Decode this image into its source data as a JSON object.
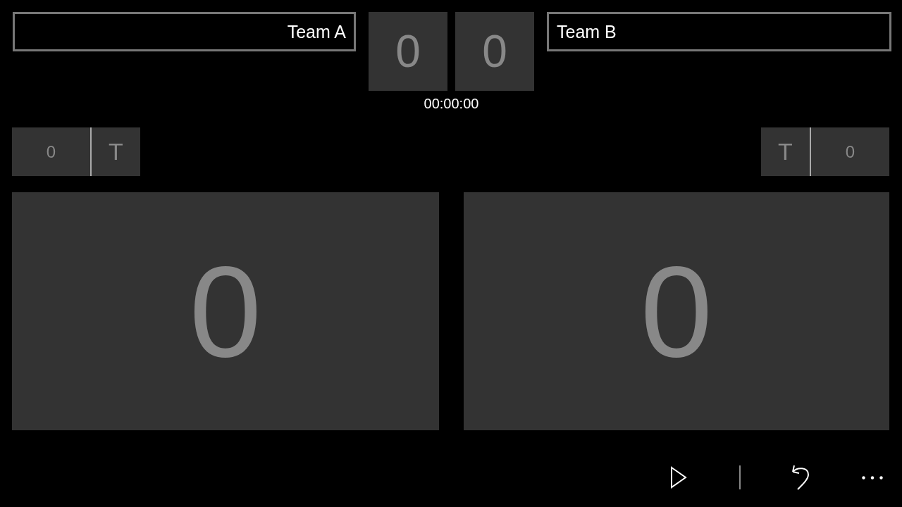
{
  "teams": [
    {
      "kind": "home",
      "name": "Team A",
      "set_score": "0",
      "timeouts": "0",
      "timeout_label": "T",
      "score": "0"
    },
    {
      "kind": "away",
      "name": "Team B",
      "set_score": "0",
      "timeouts": "0",
      "timeout_label": "T",
      "score": "0"
    }
  ],
  "clock": "00:00:00"
}
